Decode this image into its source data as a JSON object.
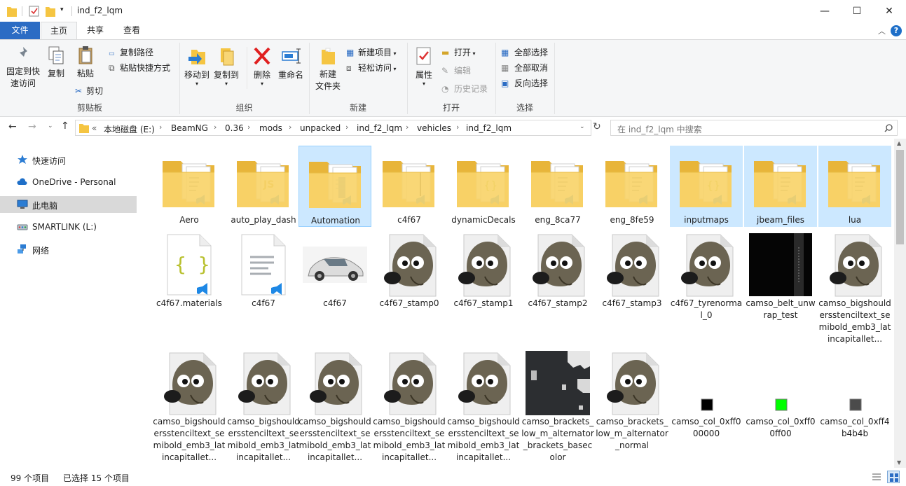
{
  "window": {
    "title": "ind_f2_lqm",
    "controls": {
      "minimize": "—",
      "maximize": "☐",
      "close": "✕"
    }
  },
  "ribbon_tabs": [
    {
      "label": "文件"
    },
    {
      "label": "主页"
    },
    {
      "label": "共享"
    },
    {
      "label": "查看"
    }
  ],
  "ribbon": {
    "clipboard": {
      "group_label": "剪贴板",
      "pin_label": "固定到快\n速访问",
      "copy_label": "复制",
      "paste_label": "粘贴",
      "copy_path_label": "复制路径",
      "paste_shortcut_label": "粘贴快捷方式",
      "cut_label": "剪切"
    },
    "organize": {
      "group_label": "组织",
      "move_to_label": "移动到",
      "copy_to_label": "复制到",
      "delete_label": "删除",
      "rename_label": "重命名"
    },
    "new": {
      "group_label": "新建",
      "new_folder_label": "新建\n文件夹",
      "new_item_label": "新建项目",
      "easy_access_label": "轻松访问"
    },
    "open": {
      "group_label": "打开",
      "properties_label": "属性",
      "open_label": "打开",
      "edit_label": "编辑",
      "history_label": "历史记录"
    },
    "select": {
      "group_label": "选择",
      "select_all_label": "全部选择",
      "select_none_label": "全部取消",
      "invert_label": "反向选择"
    }
  },
  "address": {
    "overflow": "«",
    "crumbs": [
      "本地磁盘 (E:)",
      "BeamNG",
      "0.36",
      "mods",
      "unpacked",
      "ind_f2_lqm",
      "vehicles",
      "ind_f2_lqm"
    ],
    "search_placeholder": "在 ind_f2_lqm 中搜索"
  },
  "nav_pane": [
    {
      "label": "快速访问",
      "icon": "star-icon"
    },
    {
      "label": "OneDrive - Personal",
      "icon": "cloud-icon"
    },
    {
      "label": "此电脑",
      "icon": "computer-icon",
      "selected": true
    },
    {
      "label": "SMARTLINK (L:)",
      "icon": "drive-icon"
    },
    {
      "label": "网络",
      "icon": "network-icon"
    }
  ],
  "files": [
    {
      "name": "Aero",
      "kind": "folder",
      "overlay": "text",
      "selected": false
    },
    {
      "name": "auto_play_dash",
      "kind": "folder",
      "overlay": "js",
      "selected": false
    },
    {
      "name": "Automation",
      "kind": "folder",
      "overlay": "doc",
      "selected": true,
      "focused": true
    },
    {
      "name": "c4f67",
      "kind": "folder",
      "overlay": "plain",
      "selected": false
    },
    {
      "name": "dynamicDecals",
      "kind": "folder",
      "overlay": "json",
      "selected": false
    },
    {
      "name": "eng_8ca77",
      "kind": "folder",
      "overlay": "text",
      "selected": false
    },
    {
      "name": "eng_8fe59",
      "kind": "folder",
      "overlay": "text",
      "selected": false
    },
    {
      "name": "inputmaps",
      "kind": "folder",
      "overlay": "json",
      "selected": true
    },
    {
      "name": "jbeam_files",
      "kind": "folder",
      "overlay": "text",
      "selected": true
    },
    {
      "name": "lua",
      "kind": "folder",
      "overlay": "text",
      "selected": true
    },
    {
      "name": "c4f67.materials",
      "kind": "json-file"
    },
    {
      "name": "c4f67",
      "kind": "text-file"
    },
    {
      "name": "c4f67",
      "kind": "car-image"
    },
    {
      "name": "c4f67_stamp0",
      "kind": "gimp"
    },
    {
      "name": "c4f67_stamp1",
      "kind": "gimp"
    },
    {
      "name": "c4f67_stamp2",
      "kind": "gimp"
    },
    {
      "name": "c4f67_stamp3",
      "kind": "gimp"
    },
    {
      "name": "c4f67_tyrenormal_0",
      "kind": "gimp"
    },
    {
      "name": "camso_belt_unwrap_test",
      "kind": "dark-image"
    },
    {
      "name": "camso_bigshouldersstenciltext_semibold_emb3_latincapitallet...",
      "kind": "gimp"
    },
    {
      "name": "camso_bigshouldersstenciltext_semibold_emb3_latincapitallet...",
      "kind": "gimp"
    },
    {
      "name": "camso_bigshouldersstenciltext_semibold_emb3_latincapitallet...",
      "kind": "gimp"
    },
    {
      "name": "camso_bigshouldersstenciltext_semibold_emb3_latincapitallet...",
      "kind": "gimp"
    },
    {
      "name": "camso_bigshouldersstenciltext_semibold_emb3_latincapitallet...",
      "kind": "gimp"
    },
    {
      "name": "camso_bigshouldersstenciltext_semibold_emb3_latincapitallet...",
      "kind": "gimp"
    },
    {
      "name": "camso_brackets_low_m_alternator_brackets_basecolor",
      "kind": "bracket-image"
    },
    {
      "name": "camso_brackets_low_m_alternator_normal",
      "kind": "gimp"
    },
    {
      "name": "camso_col_0xff000000",
      "kind": "swatch",
      "color": "#000000"
    },
    {
      "name": "camso_col_0xff00ff00",
      "kind": "swatch",
      "color": "#00ff00"
    },
    {
      "name": "camso_col_0xff4b4b4b",
      "kind": "swatch",
      "color": "#4b4b4b"
    }
  ],
  "status": {
    "count": "99 个项目",
    "selected": "已选择 15 个项目"
  }
}
